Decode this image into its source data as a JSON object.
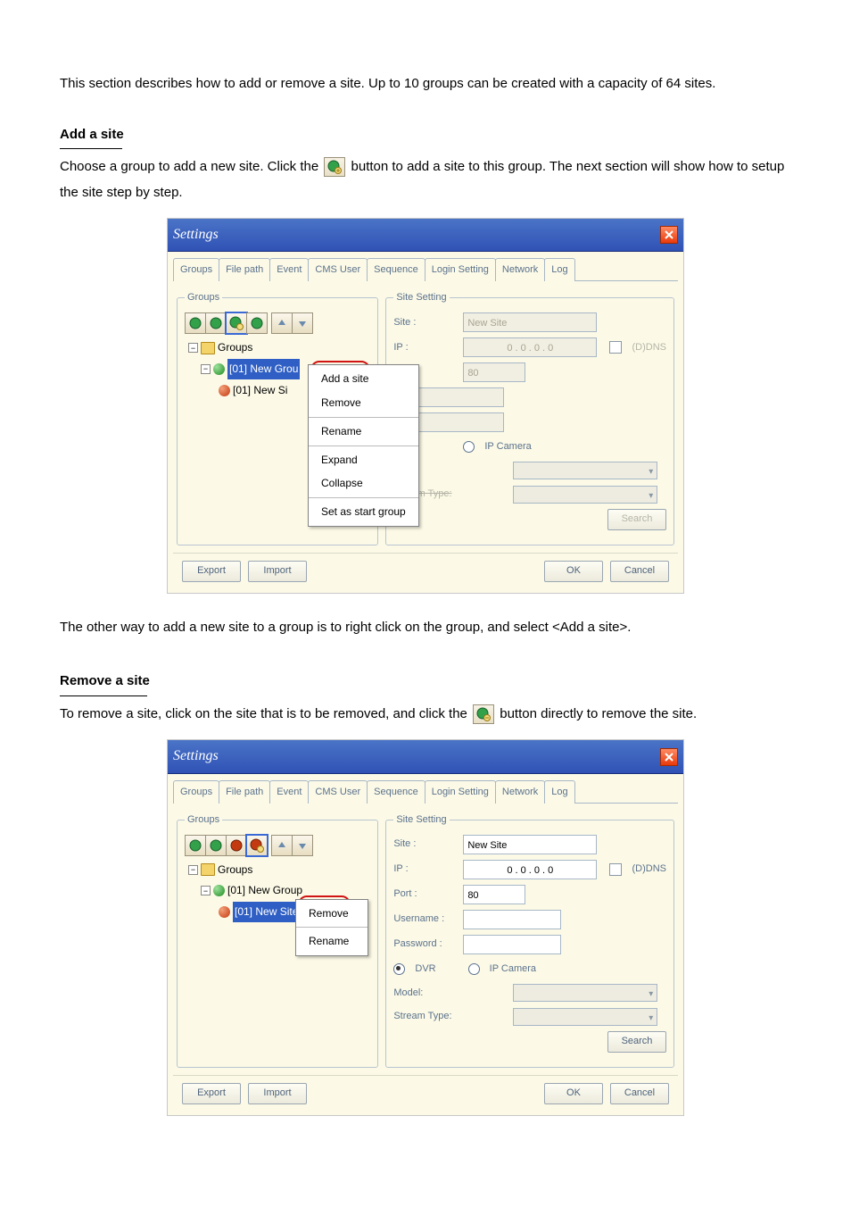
{
  "intro": "This section describes how to add or remove a site. Up to 10 groups can be created with a capacity of 64 sites.",
  "add": {
    "heading": "Add a site",
    "para_a": "Choose a group to add a new site. Click the",
    "para_b": "button to add a site to this group. The next section will show how to setup the site step by step.",
    "outro": "The other way to add a new site to a group is to right click on the group, and select <Add a site>."
  },
  "remove": {
    "heading": "Remove a site",
    "para_a": "To remove a site, click on the site that is to be removed, and click the",
    "para_b": "button directly to remove the site."
  },
  "win": {
    "title": "Settings",
    "tabs": [
      "Groups",
      "File path",
      "Event",
      "CMS User",
      "Sequence",
      "Login Setting",
      "Network",
      "Log"
    ],
    "groups_legend": "Groups",
    "site_legend": "Site Setting",
    "tree_root": "Groups",
    "tree_group": "[01] New Group",
    "tree_site_trunc_a": "[01] New Si",
    "tree_site_trunc_b": "[01] New Site",
    "tree_group_trunc": "[01] New Grou",
    "ctx1": [
      "Add a site",
      "Remove",
      "Rename",
      "Expand",
      "Collapse",
      "Set as start group"
    ],
    "ctx2": [
      "Remove",
      "Rename"
    ],
    "form": {
      "site_lbl": "Site :",
      "site_val": "New Site",
      "ip_lbl": "IP :",
      "ip_val": "0   .   0   .   0   .   0",
      "ddns_lbl": "(D)DNS",
      "port_lbl": "Port :",
      "port_val": "80",
      "user_lbl": "Username :",
      "pass_lbl": "Password :",
      "dvr_lbl": "DVR",
      "ipcam_lbl": "IP Camera",
      "model_lbl": "Model:",
      "stream_lbl": "Stream Type:",
      "search_btn": "Search"
    },
    "buttons": {
      "export": "Export",
      "import": "Import",
      "ok": "OK",
      "cancel": "Cancel"
    }
  }
}
